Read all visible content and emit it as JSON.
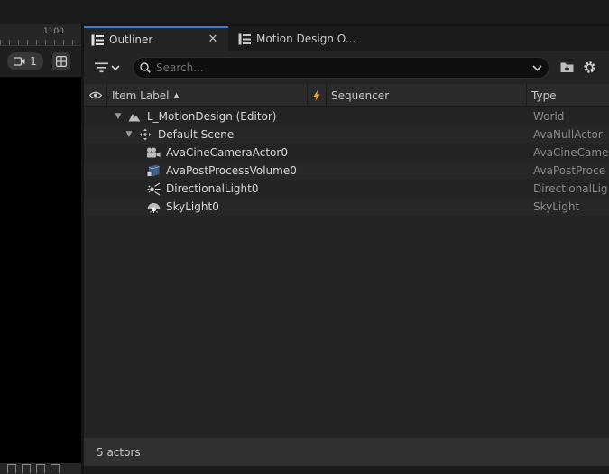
{
  "viewport": {
    "ruler_label": "1100",
    "camera_count": "1"
  },
  "tabs": [
    {
      "label": "Outliner",
      "active": true
    },
    {
      "label": "Motion Design O...",
      "active": false
    }
  ],
  "search": {
    "placeholder": "Search...",
    "value": ""
  },
  "columns": {
    "label": "Item Label",
    "sequencer": "Sequencer",
    "type": "Type"
  },
  "rows": [
    {
      "label": "L_MotionDesign (Editor)",
      "type": "World",
      "icon": "level-icon",
      "depth": 0,
      "expanded": true
    },
    {
      "label": "Default Scene",
      "type": "AvaNullActor",
      "icon": "null-actor-icon",
      "depth": 1,
      "expanded": true
    },
    {
      "label": "AvaCineCameraActor0",
      "type": "AvaCineCame",
      "icon": "cine-camera-icon",
      "depth": 2
    },
    {
      "label": "AvaPostProcessVolume0",
      "type": "AvaPostProce",
      "icon": "post-process-icon",
      "depth": 2
    },
    {
      "label": "DirectionalLight0",
      "type": "DirectionalLig",
      "icon": "directional-light-icon",
      "depth": 2
    },
    {
      "label": "SkyLight0",
      "type": "SkyLight",
      "icon": "sky-light-icon",
      "depth": 2
    }
  ],
  "footer": {
    "status": "5 actors"
  },
  "colors": {
    "accent": "#3d7be3",
    "pin": "#e8a33a"
  }
}
